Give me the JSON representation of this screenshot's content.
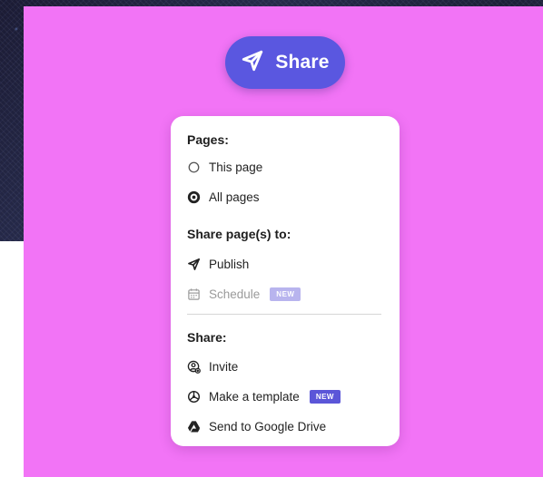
{
  "share_button": {
    "label": "Share",
    "icon": "send-icon"
  },
  "menu": {
    "pages_section": {
      "title": "Pages:",
      "options": [
        {
          "label": "This page",
          "selected": false
        },
        {
          "label": "All pages",
          "selected": true
        }
      ]
    },
    "share_to_section": {
      "title": "Share page(s) to:",
      "items": [
        {
          "label": "Publish",
          "icon": "send-icon",
          "disabled": false,
          "badge": ""
        },
        {
          "label": "Schedule",
          "icon": "calendar-icon",
          "disabled": true,
          "badge": "NEW"
        }
      ]
    },
    "share_section": {
      "title": "Share:",
      "items": [
        {
          "label": "Invite",
          "icon": "add-user-icon",
          "badge": ""
        },
        {
          "label": "Make a template",
          "icon": "template-icon",
          "badge": "NEW"
        },
        {
          "label": "Send to Google Drive",
          "icon": "google-drive-icon",
          "badge": ""
        }
      ]
    }
  },
  "colors": {
    "panel_background": "#f274f6",
    "share_button_background": "#5a57e0",
    "badge_background": "#5b56d8",
    "badge_muted_background": "#b8b4ee"
  }
}
